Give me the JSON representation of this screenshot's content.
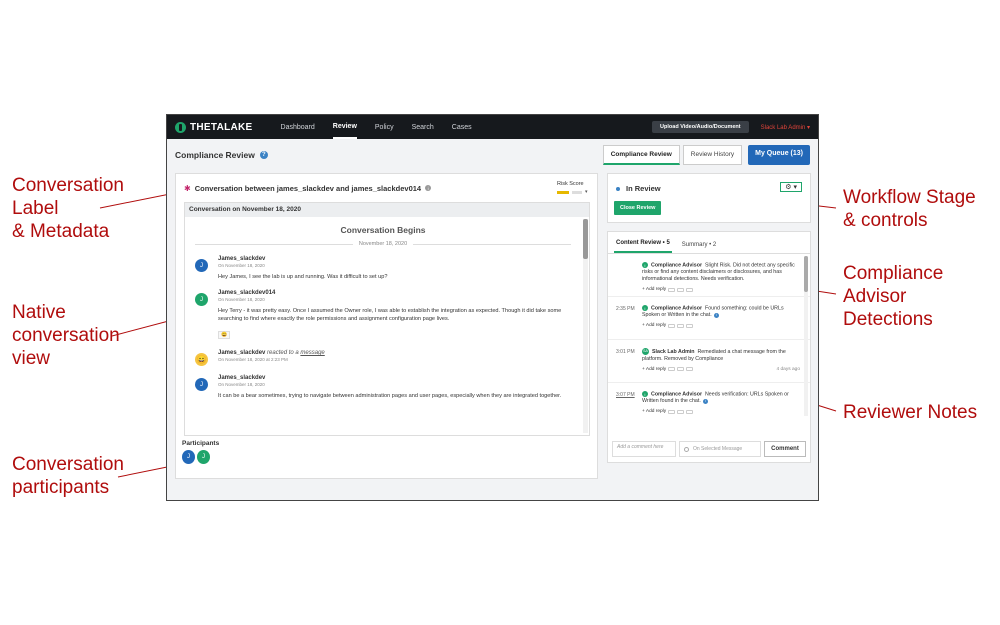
{
  "annotations": {
    "conversation_label": [
      "Conversation",
      "Label",
      "& Metadata"
    ],
    "native_view": [
      "Native",
      "conversation",
      "view"
    ],
    "participants": [
      "Conversation",
      "participants"
    ],
    "workflow": [
      "Workflow Stage",
      "& controls"
    ],
    "detections": [
      "Compliance",
      "Advisor",
      "Detections"
    ],
    "reviewer_notes": [
      "Reviewer Notes"
    ]
  },
  "nav": {
    "logo": "THETALAKE",
    "items": [
      "Dashboard",
      "Review",
      "Policy",
      "Search",
      "Cases"
    ],
    "upload_label": "Upload Video/Audio/Document",
    "user_label": "Slack Lab Admin ▾"
  },
  "subheader": {
    "title": "Compliance Review",
    "help": "?",
    "tabs": [
      "Compliance Review",
      "Review History"
    ],
    "queue_label": "My Queue (13)"
  },
  "conversation": {
    "label": "Conversation between james_slackdev and james_slackdev014",
    "info": "i",
    "risk_label": "Risk Score",
    "risk_caret": "▾",
    "date_bar": "Conversation on November 18, 2020",
    "begins": "Conversation Begins",
    "divider_date": "November 18, 2020",
    "messages": [
      {
        "initial": "J",
        "author": "James_slackdev",
        "time": "On November 18, 2020",
        "text": "Hey James, I see the lab is up and running. Was it difficult to set up?"
      },
      {
        "initial": "J",
        "author": "James_slackdev014",
        "time": "On November 18, 2020",
        "text": "Hey Terry - it was pretty easy. Once I assumed the Owner role, I was able to establish the integration as expected. Though it did take some searching to find where exactly the role permissions and assignment configuration page lives.",
        "reaction": "😄"
      },
      {
        "initial": "😄",
        "author": "James_slackdev",
        "reacted": "reacted to a",
        "link": "message",
        "time": "On November 18, 2020 at 2:23 PM"
      },
      {
        "initial": "J",
        "author": "James_slackdev",
        "time": "On November 18, 2020",
        "text": "It can be a bear sometimes, trying to navigate between administration pages and user pages, especially when they are integrated together."
      }
    ],
    "participants_label": "Participants",
    "participants": [
      "J",
      "J"
    ]
  },
  "workflow": {
    "stage": "In Review",
    "close_label": "Close Review",
    "gear": "⚙ ▾"
  },
  "detections": {
    "tabs": [
      "Content Review • 5",
      "Summary • 2"
    ],
    "items": [
      {
        "time": "",
        "icon": "i",
        "author": "Compliance Advisor",
        "text": "Slight Risk. Did not detect any specific risks or find any content disclaimers or disclosures, and has informational detections. Needs verification.",
        "reply": "+ Add reply",
        "ago": ""
      },
      {
        "time": "2:35 PM",
        "icon": "i",
        "author": "Compliance Advisor",
        "text": "Found something: could be URLs Spoken or Written in the chat.",
        "reply": "+ Add reply",
        "ago": ""
      },
      {
        "time": "3:01 PM",
        "icon": "SA",
        "author": "Slack Lab Admin",
        "text": "Remediated a chat message from the platform. Removed by Compliance",
        "reply": "+ Add reply",
        "ago": "4 days ago"
      },
      {
        "time": "3:07 PM",
        "icon": "i",
        "author": "Compliance Advisor",
        "text": "Needs verification: URLs Spoken or Written found in the chat.",
        "reply": "+ Add reply",
        "ago": ""
      }
    ],
    "comment_placeholder": "Add a comment here",
    "on_selected": "On Selected Message",
    "comment_label": "Comment"
  },
  "colors": {
    "annotation": "#b00d0d",
    "brand_green": "#1fa56b",
    "primary_blue": "#2268b8",
    "nav_bg": "#16191d"
  }
}
